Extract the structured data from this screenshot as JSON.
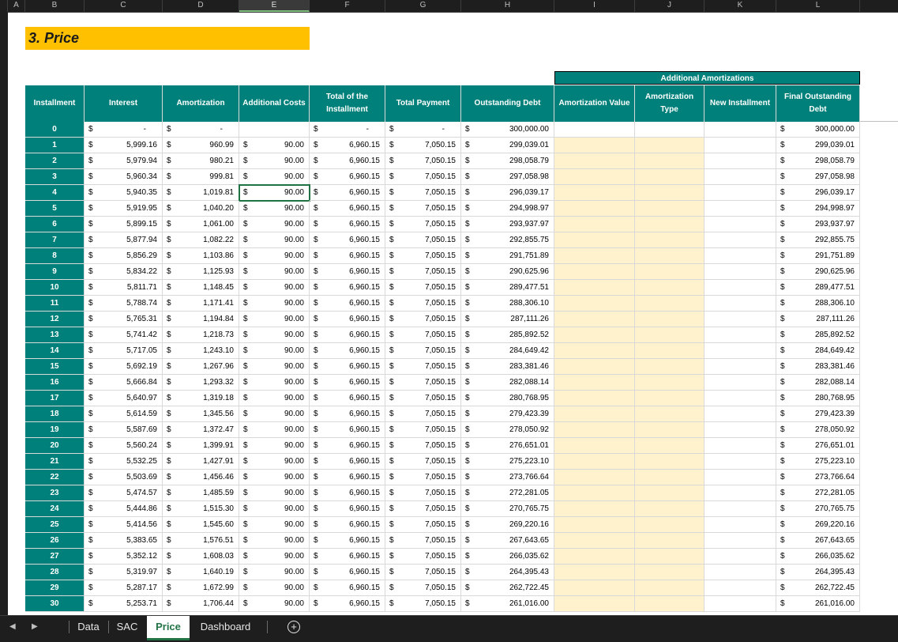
{
  "columns": [
    "A",
    "B",
    "C",
    "D",
    "E",
    "F",
    "G",
    "H",
    "I",
    "J",
    "K",
    "L"
  ],
  "selected_column": "E",
  "row_numbers": [
    "",
    "",
    "",
    "",
    "",
    "",
    "",
    "",
    "",
    "",
    "",
    "",
    "",
    "",
    "",
    "",
    "",
    "",
    "",
    "",
    "",
    "",
    "",
    "",
    "",
    "",
    "",
    "",
    "",
    "",
    "",
    "",
    "",
    "",
    "",
    "",
    ""
  ],
  "title": "3. Price",
  "additional_amortizations_label": "Additional Amortizations",
  "headers": [
    "Installment",
    "Interest",
    "Amortization",
    "Additional Costs",
    "Total of the Installment",
    "Total Payment",
    "Outstanding Debt",
    "Amortization Value",
    "Amortization Type",
    "New Installment",
    "Final Outstanding Debt"
  ],
  "currency_symbol": "$",
  "rows": [
    [
      "0",
      "-",
      "-",
      "",
      "-",
      "-",
      "300,000.00",
      "300,000.00"
    ],
    [
      "1",
      "5,999.16",
      "960.99",
      "90.00",
      "6,960.15",
      "7,050.15",
      "299,039.01",
      "299,039.01"
    ],
    [
      "2",
      "5,979.94",
      "980.21",
      "90.00",
      "6,960.15",
      "7,050.15",
      "298,058.79",
      "298,058.79"
    ],
    [
      "3",
      "5,960.34",
      "999.81",
      "90.00",
      "6,960.15",
      "7,050.15",
      "297,058.98",
      "297,058.98"
    ],
    [
      "4",
      "5,940.35",
      "1,019.81",
      "90.00",
      "6,960.15",
      "7,050.15",
      "296,039.17",
      "296,039.17"
    ],
    [
      "5",
      "5,919.95",
      "1,040.20",
      "90.00",
      "6,960.15",
      "7,050.15",
      "294,998.97",
      "294,998.97"
    ],
    [
      "6",
      "5,899.15",
      "1,061.00",
      "90.00",
      "6,960.15",
      "7,050.15",
      "293,937.97",
      "293,937.97"
    ],
    [
      "7",
      "5,877.94",
      "1,082.22",
      "90.00",
      "6,960.15",
      "7,050.15",
      "292,855.75",
      "292,855.75"
    ],
    [
      "8",
      "5,856.29",
      "1,103.86",
      "90.00",
      "6,960.15",
      "7,050.15",
      "291,751.89",
      "291,751.89"
    ],
    [
      "9",
      "5,834.22",
      "1,125.93",
      "90.00",
      "6,960.15",
      "7,050.15",
      "290,625.96",
      "290,625.96"
    ],
    [
      "10",
      "5,811.71",
      "1,148.45",
      "90.00",
      "6,960.15",
      "7,050.15",
      "289,477.51",
      "289,477.51"
    ],
    [
      "11",
      "5,788.74",
      "1,171.41",
      "90.00",
      "6,960.15",
      "7,050.15",
      "288,306.10",
      "288,306.10"
    ],
    [
      "12",
      "5,765.31",
      "1,194.84",
      "90.00",
      "6,960.15",
      "7,050.15",
      "287,111.26",
      "287,111.26"
    ],
    [
      "13",
      "5,741.42",
      "1,218.73",
      "90.00",
      "6,960.15",
      "7,050.15",
      "285,892.52",
      "285,892.52"
    ],
    [
      "14",
      "5,717.05",
      "1,243.10",
      "90.00",
      "6,960.15",
      "7,050.15",
      "284,649.42",
      "284,649.42"
    ],
    [
      "15",
      "5,692.19",
      "1,267.96",
      "90.00",
      "6,960.15",
      "7,050.15",
      "283,381.46",
      "283,381.46"
    ],
    [
      "16",
      "5,666.84",
      "1,293.32",
      "90.00",
      "6,960.15",
      "7,050.15",
      "282,088.14",
      "282,088.14"
    ],
    [
      "17",
      "5,640.97",
      "1,319.18",
      "90.00",
      "6,960.15",
      "7,050.15",
      "280,768.95",
      "280,768.95"
    ],
    [
      "18",
      "5,614.59",
      "1,345.56",
      "90.00",
      "6,960.15",
      "7,050.15",
      "279,423.39",
      "279,423.39"
    ],
    [
      "19",
      "5,587.69",
      "1,372.47",
      "90.00",
      "6,960.15",
      "7,050.15",
      "278,050.92",
      "278,050.92"
    ],
    [
      "20",
      "5,560.24",
      "1,399.91",
      "90.00",
      "6,960.15",
      "7,050.15",
      "276,651.01",
      "276,651.01"
    ],
    [
      "21",
      "5,532.25",
      "1,427.91",
      "90.00",
      "6,960.15",
      "7,050.15",
      "275,223.10",
      "275,223.10"
    ],
    [
      "22",
      "5,503.69",
      "1,456.46",
      "90.00",
      "6,960.15",
      "7,050.15",
      "273,766.64",
      "273,766.64"
    ],
    [
      "23",
      "5,474.57",
      "1,485.59",
      "90.00",
      "6,960.15",
      "7,050.15",
      "272,281.05",
      "272,281.05"
    ],
    [
      "24",
      "5,444.86",
      "1,515.30",
      "90.00",
      "6,960.15",
      "7,050.15",
      "270,765.75",
      "270,765.75"
    ],
    [
      "25",
      "5,414.56",
      "1,545.60",
      "90.00",
      "6,960.15",
      "7,050.15",
      "269,220.16",
      "269,220.16"
    ],
    [
      "26",
      "5,383.65",
      "1,576.51",
      "90.00",
      "6,960.15",
      "7,050.15",
      "267,643.65",
      "267,643.65"
    ],
    [
      "27",
      "5,352.12",
      "1,608.03",
      "90.00",
      "6,960.15",
      "7,050.15",
      "266,035.62",
      "266,035.62"
    ],
    [
      "28",
      "5,319.97",
      "1,640.19",
      "90.00",
      "6,960.15",
      "7,050.15",
      "264,395.43",
      "264,395.43"
    ],
    [
      "29",
      "5,287.17",
      "1,672.99",
      "90.00",
      "6,960.15",
      "7,050.15",
      "262,722.45",
      "262,722.45"
    ],
    [
      "30",
      "5,253.71",
      "1,706.44",
      "90.00",
      "6,960.15",
      "7,050.15",
      "261,016.00",
      "261,016.00"
    ]
  ],
  "sheet_tabs": [
    "Data",
    "SAC",
    "Price",
    "Dashboard"
  ],
  "active_tab": "Price",
  "nav_icons": {
    "prev": "chevron-left-icon",
    "next": "chevron-right-icon",
    "add": "plus-circle-icon"
  },
  "add_sheet_glyph": "+",
  "colors": {
    "teal": "#00807a",
    "title_bg": "#ffc000",
    "input_bg": "#fff2cc",
    "accent": "#217346"
  }
}
